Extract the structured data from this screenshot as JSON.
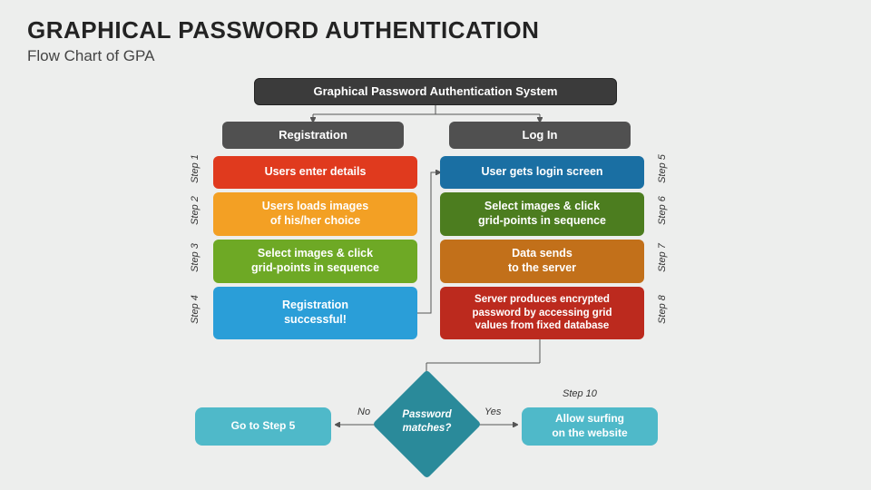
{
  "title": "GRAPHICAL PASSWORD AUTHENTICATION",
  "subtitle": "Flow Chart of GPA",
  "top": "Graphical Password Authentication System",
  "headers": {
    "left": "Registration",
    "right": "Log In"
  },
  "steps_left": [
    {
      "label": "Step 1",
      "text": "Users enter details"
    },
    {
      "label": "Step 2",
      "text": "Users loads images\nof his/her choice"
    },
    {
      "label": "Step 3",
      "text": "Select images & click\ngrid-points in sequence"
    },
    {
      "label": "Step 4",
      "text": "Registration\nsuccessful!"
    }
  ],
  "steps_right": [
    {
      "label": "Step 5",
      "text": "User gets login screen"
    },
    {
      "label": "Step 6",
      "text": "Select images & click\ngrid-points in sequence"
    },
    {
      "label": "Step 7",
      "text": "Data sends\nto the server"
    },
    {
      "label": "Step 8",
      "text": "Server produces encrypted\npassword by accessing grid\nvalues from fixed database"
    }
  ],
  "decision": {
    "text": "Password\nmatches?",
    "no": "No",
    "yes": "Yes",
    "step": "Step 10"
  },
  "outcomes": {
    "no": "Go to Step 5",
    "yes": "Allow surfing\non the website"
  }
}
